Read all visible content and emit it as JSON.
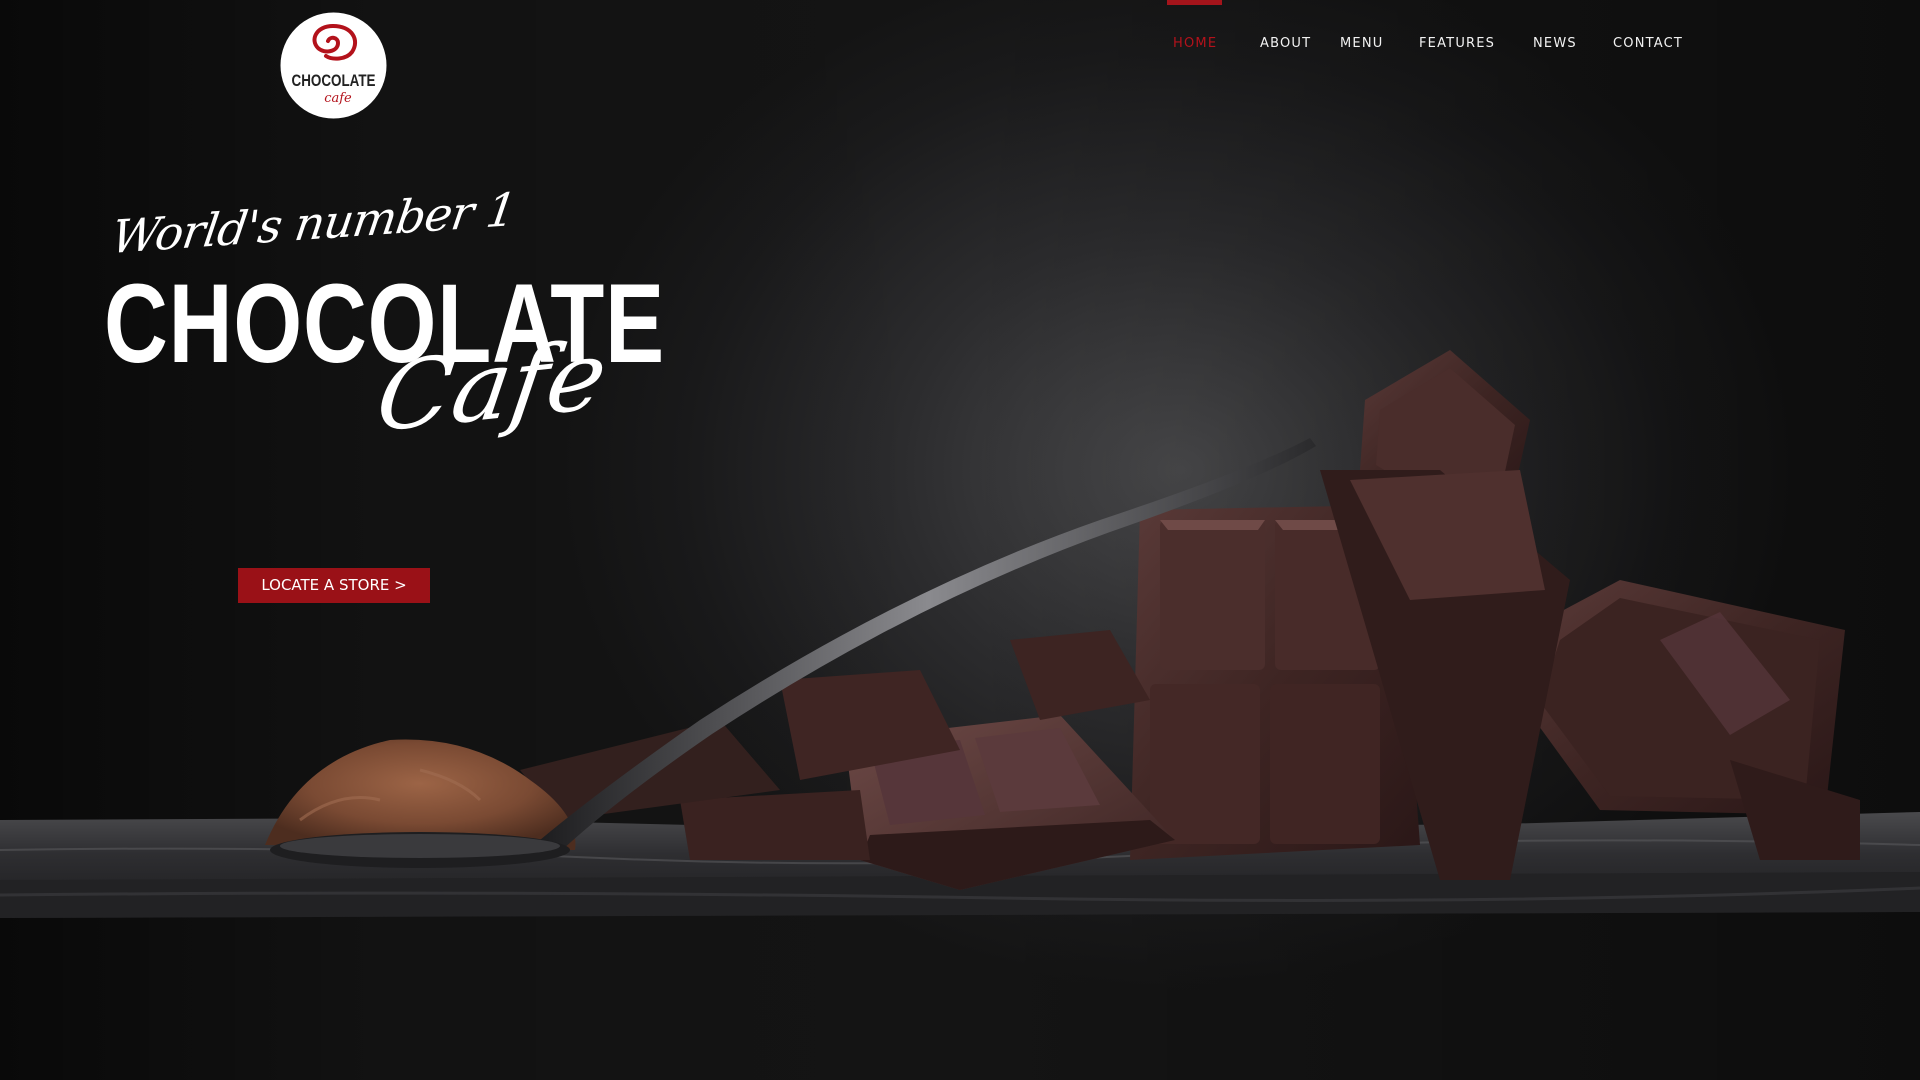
{
  "brand": {
    "logo_text_top": "CHOCOLATE",
    "logo_text_bottom": "cafe",
    "accent_color": "#a4141b"
  },
  "nav": {
    "items": [
      {
        "label": "HOME",
        "active": true
      },
      {
        "label": "ABOUT",
        "active": false
      },
      {
        "label": "MENU",
        "active": false
      },
      {
        "label": "FEATURES",
        "active": false
      },
      {
        "label": "NEWS",
        "active": false
      },
      {
        "label": "CONTACT",
        "active": false
      }
    ]
  },
  "hero": {
    "script_top": "World's number 1",
    "title": "CHOCOLATE",
    "script_bottom": "Cafe",
    "cta_label": "LOCATE A STORE >"
  }
}
